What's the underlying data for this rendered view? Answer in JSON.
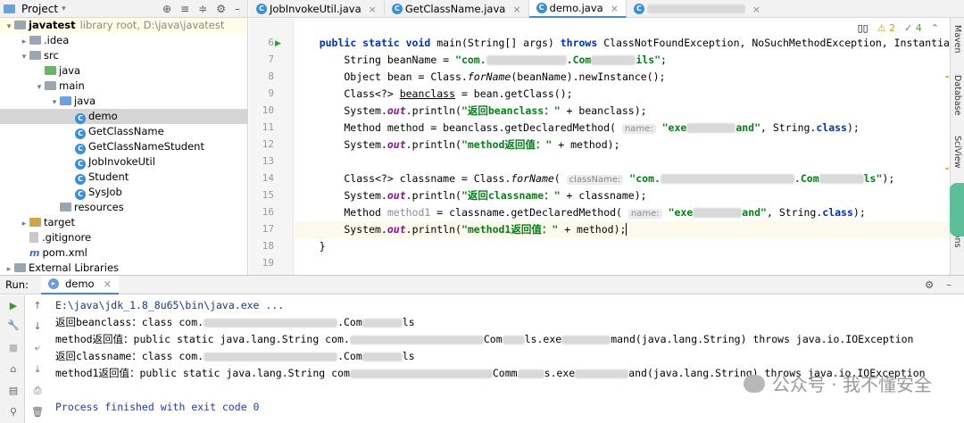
{
  "project": {
    "title": "Project",
    "tree": [
      {
        "name": "javatest",
        "note": "library root,  D:\\java\\javatest",
        "level": 0,
        "arrow": "▾",
        "icon": "folder-grey"
      },
      {
        "name": ".idea",
        "level": 1,
        "arrow": "▸",
        "icon": "folder-grey"
      },
      {
        "name": "src",
        "level": 1,
        "arrow": "▾",
        "icon": "folder-grey"
      },
      {
        "name": "java",
        "level": 2,
        "arrow": "",
        "icon": "folder-green"
      },
      {
        "name": "main",
        "level": 2,
        "arrow": "▾",
        "icon": "folder-grey"
      },
      {
        "name": "java",
        "level": 3,
        "arrow": "▾",
        "icon": "folder-blue"
      },
      {
        "name": "demo",
        "level": 4,
        "arrow": "",
        "icon": "class",
        "selected": true
      },
      {
        "name": "GetClassName",
        "level": 4,
        "arrow": "",
        "icon": "class"
      },
      {
        "name": "GetClassNameStudent",
        "level": 4,
        "arrow": "",
        "icon": "class"
      },
      {
        "name": "JobInvokeUtil",
        "level": 4,
        "arrow": "",
        "icon": "class"
      },
      {
        "name": "Student",
        "level": 4,
        "arrow": "",
        "icon": "class"
      },
      {
        "name": "SysJob",
        "level": 4,
        "arrow": "",
        "icon": "class"
      },
      {
        "name": "resources",
        "level": 3,
        "arrow": "",
        "icon": "folder-grey"
      },
      {
        "name": "target",
        "level": 1,
        "arrow": "▸",
        "icon": "folder-orange"
      },
      {
        "name": ".gitignore",
        "level": 1,
        "arrow": "",
        "icon": "file"
      },
      {
        "name": "pom.xml",
        "level": 1,
        "arrow": "",
        "icon": "maven"
      },
      {
        "name": "External Libraries",
        "level": 0,
        "arrow": "▸",
        "icon": "folder-grey"
      }
    ]
  },
  "tabs": [
    {
      "label": "JobInvokeUtil.java",
      "active": false
    },
    {
      "label": "GetClassName.java",
      "active": false
    },
    {
      "label": "demo.java",
      "active": true
    },
    {
      "label": "",
      "active": false,
      "blurred": true
    }
  ],
  "editor_toolbar": {
    "warnings": "2",
    "checks": "4"
  },
  "gutter": {
    "lines": [
      "6",
      "7",
      "8",
      "9",
      "10",
      "11",
      "12",
      "13",
      "14",
      "15",
      "16",
      "17",
      "18",
      "19"
    ]
  },
  "right_strip": {
    "labels": [
      "Maven",
      "Database",
      "SciView",
      "ions"
    ]
  },
  "run": {
    "label": "Run:",
    "tab": "demo",
    "console": {
      "cmd": "E:\\java\\jdk_1.8_8u65\\bin\\java.exe ...",
      "l1a": "返回beanclass：class com.",
      "l1b": ".Com",
      "l1c": "ls",
      "l2a": "method返回值：public static java.lang.String com.",
      "l2b": "Com",
      "l2c": "ls.exe",
      "l2d": "mand(java.lang.String) throws java.io.IOException",
      "l3a": "返回classname：class com.",
      "l3b": ".Com",
      "l3c": "ls",
      "l4a": "method1返回值：public static java.lang.String com",
      "l4b": "Comm",
      "l4c": "s.exe",
      "l4d": "and(java.lang.String) throws java.io.IOException",
      "exit": "Process finished with exit code 0"
    }
  },
  "watermark": {
    "text": "公众号 · 我不懂安全"
  },
  "colors": {
    "keyword": "#0033b3",
    "string": "#067d17",
    "field": "#871094",
    "accent": "#4a88c7"
  }
}
